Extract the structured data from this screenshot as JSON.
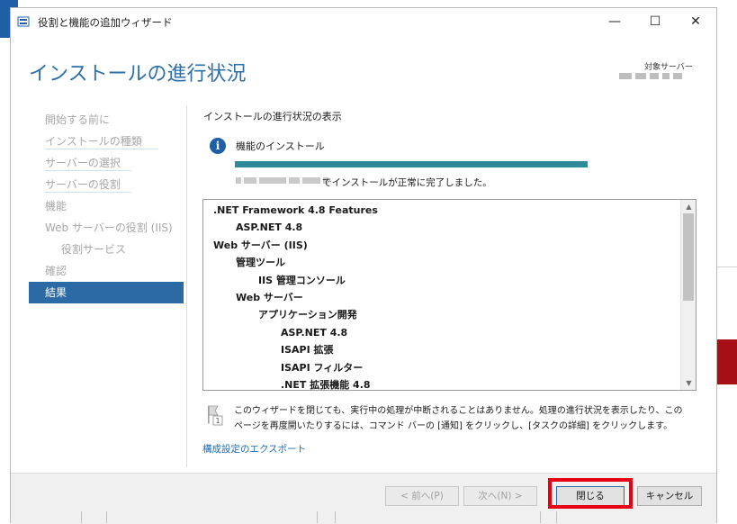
{
  "window": {
    "title": "役割と機能の追加ウィザード",
    "minimize": "—",
    "maximize": "☐",
    "close": "✕"
  },
  "header": {
    "page_title": "インストールの進行状況",
    "target_server_label": "対象サーバー"
  },
  "nav": {
    "items": [
      {
        "label": "開始する前に",
        "active": false
      },
      {
        "label": "インストールの種類",
        "active": false
      },
      {
        "label": "サーバーの選択",
        "active": false
      },
      {
        "label": "サーバーの役割",
        "active": false
      },
      {
        "label": "機能",
        "active": false
      },
      {
        "label": "Web サーバーの役割 (IIS)",
        "active": false
      },
      {
        "label": "役割サービス",
        "active": false
      },
      {
        "label": "確認",
        "active": false
      },
      {
        "label": "結果",
        "active": true
      }
    ]
  },
  "content": {
    "section_title": "インストールの進行状況の表示",
    "feature_label": "機能のインストール",
    "progress": 1.0,
    "success_text": "でインストールが正常に完了しました。",
    "list": [
      {
        "text": ".NET Framework 4.8 Features",
        "level": 0
      },
      {
        "text": "ASP.NET 4.8",
        "level": 1
      },
      {
        "text": "Web サーバー (IIS)",
        "level": 0
      },
      {
        "text": "管理ツール",
        "level": 1
      },
      {
        "text": "IIS 管理コンソール",
        "level": 2
      },
      {
        "text": "Web サーバー",
        "level": 1
      },
      {
        "text": "アプリケーション開発",
        "level": 2
      },
      {
        "text": "ASP.NET 4.8",
        "level": 3
      },
      {
        "text": "ISAPI 拡張",
        "level": 3
      },
      {
        "text": "ISAPI フィルター",
        "level": 3
      },
      {
        "text": ".NET 拡張機能 4.8",
        "level": 3
      }
    ],
    "note_line1": "このウィザードを閉じても、実行中の処理が中断されることはありません。処理の進行状況を表示したり、この",
    "note_line2": "ページを再度開いたりするには、コマンド バーの [通知] をクリックし、[タスクの詳細] をクリックします。",
    "export_link": "構成設定のエクスポート"
  },
  "buttons": {
    "prev": "< 前へ(P)",
    "next": "次へ(N) >",
    "close": "閉じる",
    "cancel": "キャンセル"
  },
  "colors": {
    "accent": "#2c6aa5",
    "progress": "#2e8a97",
    "highlight": "#e60012"
  }
}
